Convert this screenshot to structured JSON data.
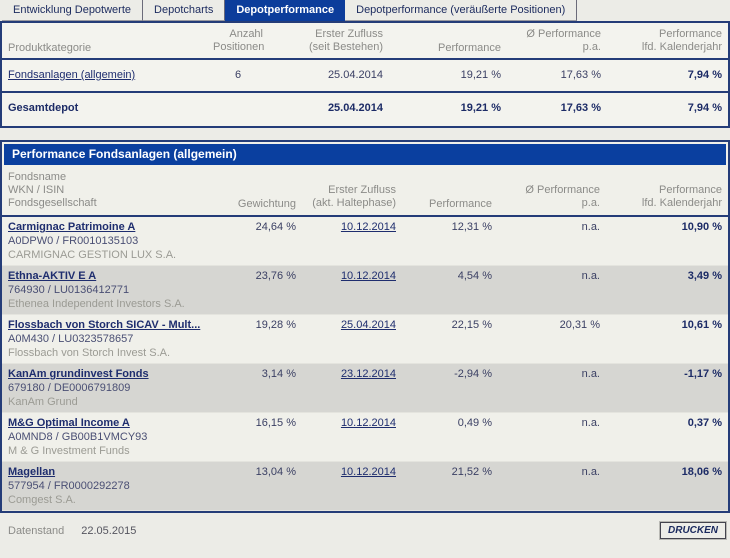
{
  "tabs": [
    {
      "label": "Entwicklung Depotwerte",
      "active": false
    },
    {
      "label": "Depotcharts",
      "active": false
    },
    {
      "label": "Depotperformance",
      "active": true
    },
    {
      "label": "Depotperformance (veräußerte Positionen)",
      "active": false
    }
  ],
  "summary": {
    "headers": {
      "produktkategorie": "Produktkategorie",
      "anzahl": [
        "Anzahl",
        "Positionen"
      ],
      "zufluss": [
        "Erster Zufluss",
        "(seit Bestehen)"
      ],
      "performance": "Performance",
      "avg": [
        "Ø Performance",
        "p.a."
      ],
      "kalenderjahr": [
        "Performance",
        "lfd. Kalenderjahr"
      ]
    },
    "rows": [
      {
        "category": "Fondsanlagen (allgemein)",
        "anzahl": "6",
        "zufluss": "25.04.2014",
        "performance": "19,21 %",
        "avg": "17,63 %",
        "kalenderjahr": "7,94 %"
      }
    ],
    "total": {
      "category": "Gesamtdepot",
      "anzahl": "",
      "zufluss": "25.04.2014",
      "performance": "19,21 %",
      "avg": "17,63 %",
      "kalenderjahr": "7,94 %"
    }
  },
  "detail": {
    "title": "Performance Fondsanlagen (allgemein)",
    "headers": {
      "name": [
        "Fondsname",
        "WKN / ISIN",
        "Fondsgesellschaft"
      ],
      "gewichtung": "Gewichtung",
      "zufluss": [
        "Erster Zufluss",
        "(akt. Haltephase)"
      ],
      "performance": "Performance",
      "avg": [
        "Ø Performance",
        "p.a."
      ],
      "kalenderjahr": [
        "Performance",
        "lfd. Kalenderjahr"
      ]
    },
    "rows": [
      {
        "name": "Carmignac Patrimoine A",
        "wkn_isin": "A0DPW0 / FR0010135103",
        "company": "CARMIGNAC GESTION LUX S.A.",
        "gewichtung": "24,64 %",
        "zufluss": "10.12.2014",
        "performance": "12,31 %",
        "avg": "n.a.",
        "kalenderjahr": "10,90 %"
      },
      {
        "name": "Ethna-AKTIV E A",
        "wkn_isin": "764930 / LU0136412771",
        "company": "Ethenea Independent Investors S.A.",
        "gewichtung": "23,76 %",
        "zufluss": "10.12.2014",
        "performance": "4,54 %",
        "avg": "n.a.",
        "kalenderjahr": "3,49 %"
      },
      {
        "name": "Flossbach von Storch SICAV - Mult...",
        "wkn_isin": "A0M430 / LU0323578657",
        "company": "Flossbach von Storch Invest S.A.",
        "gewichtung": "19,28 %",
        "zufluss": "25.04.2014",
        "performance": "22,15 %",
        "avg": "20,31 %",
        "kalenderjahr": "10,61 %"
      },
      {
        "name": "KanAm grundinvest Fonds",
        "wkn_isin": "679180 / DE0006791809",
        "company": "KanAm Grund",
        "gewichtung": "3,14 %",
        "zufluss": "23.12.2014",
        "performance": "-2,94 %",
        "avg": "n.a.",
        "kalenderjahr": "-1,17 %"
      },
      {
        "name": "M&G Optimal Income A",
        "wkn_isin": "A0MND8 / GB00B1VMCY93",
        "company": "M & G Investment Funds",
        "gewichtung": "16,15 %",
        "zufluss": "10.12.2014",
        "performance": "0,49 %",
        "avg": "n.a.",
        "kalenderjahr": "0,37 %"
      },
      {
        "name": "Magellan",
        "wkn_isin": "577954 / FR0000292278",
        "company": "Comgest S.A.",
        "gewichtung": "13,04 %",
        "zufluss": "10.12.2014",
        "performance": "21,52 %",
        "avg": "n.a.",
        "kalenderjahr": "18,06 %"
      }
    ]
  },
  "footer": {
    "datenstand_label": "Datenstand",
    "datenstand_date": "22.05.2015",
    "print_label": "DRUCKEN"
  },
  "colors": {
    "accent_blue": "#0A3F9F",
    "active_tab_blue": "#0C3D9B",
    "border_navy": "#243C78",
    "row_alt_gray": "#D6D6D2",
    "link_navy": "#1E2D6E"
  }
}
